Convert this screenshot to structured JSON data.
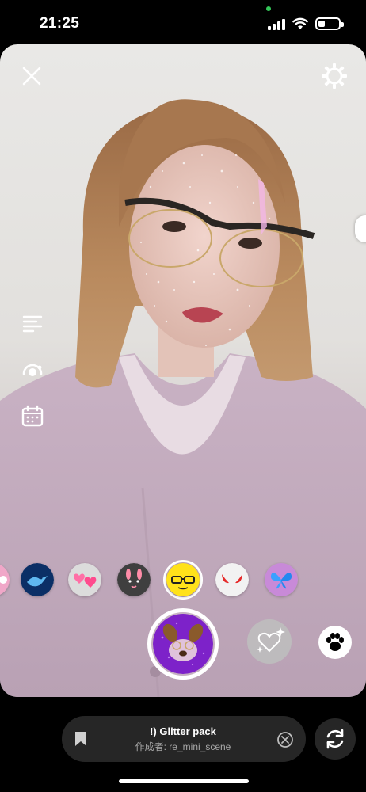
{
  "status_bar": {
    "time": "21:25",
    "battery_level": 0.35,
    "signal_bars": 4,
    "camera_in_use_indicator_color": "#34c759"
  },
  "camera_controls": {
    "close_icon": "close-icon",
    "settings_icon": "gear-icon",
    "side_tools": [
      {
        "icon": "text-lines-icon"
      },
      {
        "icon": "boomerang-icon"
      },
      {
        "icon": "calendar-icon"
      }
    ]
  },
  "effects_carousel": {
    "items": [
      {
        "icon": "pink-partial-icon"
      },
      {
        "icon": "blue-bird-icon"
      },
      {
        "icon": "pink-hearts-icon"
      },
      {
        "icon": "bunny-face-icon"
      },
      {
        "icon": "yellow-glasses-face-icon",
        "selected": true
      },
      {
        "icon": "devil-horns-icon"
      },
      {
        "icon": "blue-butterfly-icon"
      }
    ],
    "capture_effect_icon": "dog-ears-glitter-icon",
    "next_effect_icon": "sparkle-heart-icon",
    "paw_icon": "paw-icon"
  },
  "effect_info": {
    "name": "!) Glitter pack",
    "author": "作成者: re_mini_scene",
    "bookmark_icon": "bookmark-icon",
    "dismiss_icon": "close-circle-icon"
  },
  "flip_camera_icon": "flip-camera-icon",
  "colors": {
    "background": "#000000",
    "pill_background": "#262626",
    "author_text": "#a8a8a8",
    "accent_white": "#ffffff"
  }
}
